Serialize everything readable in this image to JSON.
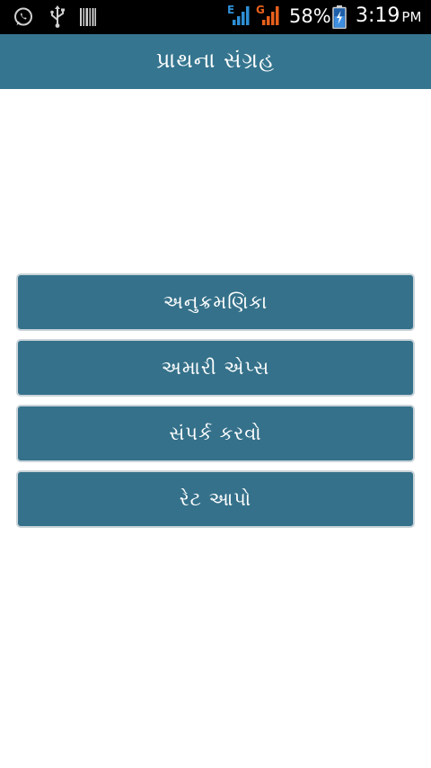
{
  "status_bar": {
    "icons_left": [
      "whatsapp-icon",
      "usb-icon",
      "barcode-icon"
    ],
    "network_labels": [
      "E",
      "G"
    ],
    "battery_percent": "58%",
    "time": "3:19",
    "ampm": "PM"
  },
  "action_bar": {
    "title": "પ્રાથના સંગ્રહ"
  },
  "menu": {
    "items": [
      {
        "label": "અનુક્રમણિકા"
      },
      {
        "label": "અમારી એપ્સ"
      },
      {
        "label": "સંપર્ક કરવો"
      },
      {
        "label": "રેટ આપો"
      }
    ]
  },
  "colors": {
    "action_bar": "#35758f",
    "button": "#35718a",
    "button_border": "#c9d4d9",
    "network_e": "#2e8fd6",
    "network_g": "#e8601c"
  }
}
